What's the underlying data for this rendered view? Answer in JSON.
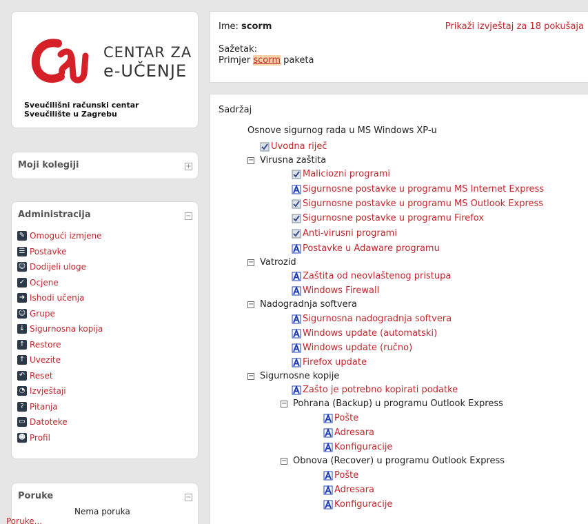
{
  "logo": {
    "line1": "CENTAR ZA",
    "line2": "e-UČENJE",
    "sub1": "Sveučilišni računski centar",
    "sub2": "Sveučilište u Zagrebu"
  },
  "kolegiji": {
    "title": "Moji kolegiji",
    "toggle": "+"
  },
  "admin": {
    "title": "Administracija",
    "toggle": "−",
    "items": [
      {
        "label": "Omogući izmjene",
        "icon": "pencil-icon",
        "glyph": "✎"
      },
      {
        "label": "Postavke",
        "icon": "clipboard-icon",
        "glyph": "☰"
      },
      {
        "label": "Dodijeli uloge",
        "icon": "users-icon",
        "glyph": "☺"
      },
      {
        "label": "Ocjene",
        "icon": "check-icon",
        "glyph": "✓"
      },
      {
        "label": "Ishodi učenja",
        "icon": "arrow-right-icon",
        "glyph": "➜"
      },
      {
        "label": "Grupe",
        "icon": "users-icon",
        "glyph": "☺"
      },
      {
        "label": "Sigurnosna kopija",
        "icon": "download-icon",
        "glyph": "↓"
      },
      {
        "label": "Restore",
        "icon": "upload-icon",
        "glyph": "↑"
      },
      {
        "label": "Uvezite",
        "icon": "upload-icon",
        "glyph": "↑"
      },
      {
        "label": "Reset",
        "icon": "undo-icon",
        "glyph": "↶"
      },
      {
        "label": "Izvještaji",
        "icon": "pie-chart-icon",
        "glyph": "◔"
      },
      {
        "label": "Pitanja",
        "icon": "question-icon",
        "glyph": "?"
      },
      {
        "label": "Datoteke",
        "icon": "folder-icon",
        "glyph": "▭"
      },
      {
        "label": "Profil",
        "icon": "user-icon",
        "glyph": "☻"
      }
    ]
  },
  "poruke": {
    "title": "Poruke",
    "toggle": "−",
    "empty": "Nema poruka",
    "link": "Poruke..."
  },
  "header": {
    "ime_label": "Ime:",
    "ime_value": "scorm",
    "report_link": "Prikaži izvještaj za 18 pokušaja",
    "sazetak_label": "Sažetak:",
    "sazetak_pre": "Primjer",
    "sazetak_hl": "scorm",
    "sazetak_post": "paketa"
  },
  "content": {
    "title": "Sadržaj",
    "toc": [
      {
        "text": "Osnove sigurnog rada u MS Windows XP-u",
        "type": "heading",
        "exp": "",
        "icon": ""
      },
      {
        "text": "Uvodna riječ",
        "type": "link",
        "exp": "",
        "icon": "completed"
      },
      {
        "text": "Virusna zaštita",
        "type": "folder",
        "exp": "−",
        "icon": ""
      },
      {
        "text": "Maliciozni programi",
        "type": "link",
        "exp": "",
        "icon": "completed"
      },
      {
        "text": "Sigurnosne postavke u programu MS Internet Express",
        "type": "link",
        "exp": "",
        "icon": "asset"
      },
      {
        "text": "Sigurnosne postavke u programu MS Outlook Express",
        "type": "link",
        "exp": "",
        "icon": "completed"
      },
      {
        "text": "Sigurnosne postavke u programu Firefox",
        "type": "link",
        "exp": "",
        "icon": "completed"
      },
      {
        "text": "Anti-virusni programi",
        "type": "link",
        "exp": "",
        "icon": "completed"
      },
      {
        "text": "Postavke u Adaware programu",
        "type": "link",
        "exp": "",
        "icon": "asset"
      },
      {
        "text": "Vatrozid",
        "type": "folder",
        "exp": "−",
        "icon": ""
      },
      {
        "text": "Zaštita od neovlaštenog pristupa",
        "type": "link",
        "exp": "",
        "icon": "asset"
      },
      {
        "text": "Windows Firewall",
        "type": "link",
        "exp": "",
        "icon": "asset"
      },
      {
        "text": "Nadogradnja softvera",
        "type": "folder",
        "exp": "−",
        "icon": ""
      },
      {
        "text": "Sigurnosna nadogradnja softvera",
        "type": "link",
        "exp": "",
        "icon": "asset"
      },
      {
        "text": "Windows update (automatski)",
        "type": "link",
        "exp": "",
        "icon": "asset"
      },
      {
        "text": "Windows update (ručno)",
        "type": "link",
        "exp": "",
        "icon": "asset"
      },
      {
        "text": "Firefox update",
        "type": "link",
        "exp": "",
        "icon": "asset"
      },
      {
        "text": "Sigurnosne kopije",
        "type": "folder",
        "exp": "−",
        "icon": ""
      },
      {
        "text": "Zašto je potrebno kopirati podatke",
        "type": "link",
        "exp": "",
        "icon": "asset"
      },
      {
        "text": "Pohrana (Backup) u programu Outlook Express",
        "type": "folder",
        "exp": "−",
        "icon": ""
      },
      {
        "text": "Pošte",
        "type": "link",
        "exp": "",
        "icon": "asset"
      },
      {
        "text": "Adresara",
        "type": "link",
        "exp": "",
        "icon": "asset"
      },
      {
        "text": "Konfiguracije",
        "type": "link",
        "exp": "",
        "icon": "asset"
      },
      {
        "text": "Obnova (Recover) u programu Outlook Express",
        "type": "folder",
        "exp": "−",
        "icon": ""
      },
      {
        "text": "Pošte",
        "type": "link",
        "exp": "",
        "icon": "asset"
      },
      {
        "text": "Adresara",
        "type": "link",
        "exp": "",
        "icon": "asset"
      },
      {
        "text": "Konfiguracije",
        "type": "link",
        "exp": "",
        "icon": "asset"
      }
    ]
  },
  "colors": {
    "link": "#c1272d",
    "icon_dark": "#2b3948",
    "highlight": "#f6d3a6"
  }
}
